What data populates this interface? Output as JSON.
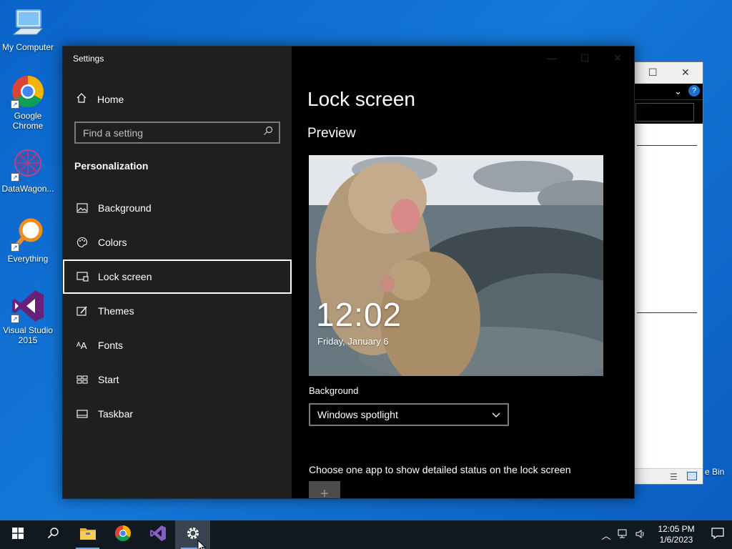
{
  "desktop": {
    "icons": [
      {
        "label": "My Computer"
      },
      {
        "label": "Google Chrome"
      },
      {
        "label": "DataWagon..."
      },
      {
        "label": "Everything"
      },
      {
        "label": "Visual Studio 2015"
      }
    ],
    "recycle_bin_label": "e Bin"
  },
  "settings": {
    "window_title": "Settings",
    "home_label": "Home",
    "search_placeholder": "Find a setting",
    "section_label": "Personalization",
    "nav_items": [
      {
        "label": "Background",
        "icon": "picture-icon"
      },
      {
        "label": "Colors",
        "icon": "palette-icon"
      },
      {
        "label": "Lock screen",
        "icon": "lock-screen-icon",
        "selected": true
      },
      {
        "label": "Themes",
        "icon": "themes-icon"
      },
      {
        "label": "Fonts",
        "icon": "fonts-icon"
      },
      {
        "label": "Start",
        "icon": "start-icon"
      },
      {
        "label": "Taskbar",
        "icon": "taskbar-icon"
      }
    ],
    "content": {
      "title": "Lock screen",
      "preview_heading": "Preview",
      "preview_time": "12:02",
      "preview_date": "Friday, January 6",
      "background_label": "Background",
      "background_value": "Windows spotlight",
      "status_label": "Choose one app to show detailed status on the lock screen",
      "add_app_label": "+"
    }
  },
  "taskbar": {
    "apps": [
      "start-icon",
      "search-icon",
      "file-explorer-icon",
      "chrome-icon",
      "visual-studio-icon",
      "settings-icon"
    ],
    "time": "12:05 PM",
    "date": "1/6/2023"
  },
  "colors": {
    "desktop_blue": "#0a63c9",
    "settings_nav_bg": "#1f1f1f",
    "settings_content_bg": "#000000",
    "taskbar_bg": "#101820"
  }
}
